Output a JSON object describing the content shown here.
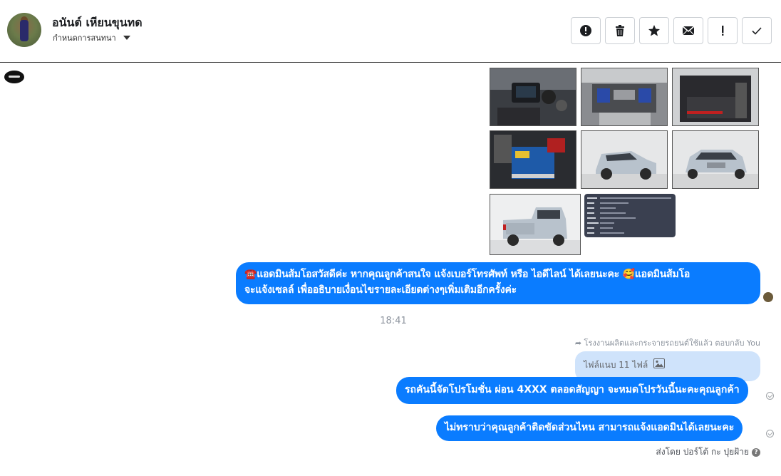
{
  "header": {
    "contact_name": "อนันต์ เหียนขุนทด",
    "assign_label": "กำหนดการสนทนา",
    "actions": [
      {
        "icon": "exclamation-circle-icon"
      },
      {
        "icon": "trash-icon"
      },
      {
        "icon": "star-icon"
      },
      {
        "icon": "envelope-icon"
      },
      {
        "icon": "exclamation-icon"
      },
      {
        "icon": "checkmark-icon"
      }
    ]
  },
  "gallery": {
    "images": [
      {
        "subject": "car interior dashboard"
      },
      {
        "subject": "engine bay"
      },
      {
        "subject": "truck bed red"
      },
      {
        "subject": "engine battery blue"
      },
      {
        "subject": "silver pickup front-left"
      },
      {
        "subject": "silver pickup front"
      },
      {
        "subject": "silver pickup rear"
      },
      {
        "subject": "vehicle info card dark"
      }
    ]
  },
  "messages": {
    "admin_message": "☎️ แอดมินส้มโอสวัสดีค่ะ หากคุณลูกค้าสนใจ แจ้งเบอร์โทรศัพท์ หรือ ไอดีไลน์  ได้เลยนะคะ 🥰 แอดมินส้มโอจะแจ้งเซลล์   เพื่ออธิบายเงื่อนไขรายละเอียดต่างๆเพิ่มเติมอีกครั้งค่ะ",
    "admin_message_line1": "☎️แอดมินส้มโอสวัสดีค่ะ หากคุณลูกค้าสนใจ แจ้งเบอร์โทรศัพท์ หรือ ไอดีไลน์  ได้เลยนะคะ 🥰แอดมินส้มโอ",
    "admin_message_line2": "จะแจ้งเซลล์   เพื่ออธิบายเงื่อนไขรายละเอียดต่างๆเพิ่มเติมอีกครั้งค่ะ",
    "timestamp": "18:41",
    "replied_label": "โรงงานผลิตและกระจายรถยนต์ใช้แล้ว ตอบกลับ You",
    "attachment_label": "ไฟล์แนบ 11 ไฟล์",
    "promo_message": "รถคันนี้จัดโปรโมชั่น ผ่อน 4XXX ตลอดสัญญา จะหมดโปรวันนี้นะคะคุณลูกค้า",
    "ask_message": "ไม่ทราบว่าคุณลูกค้าติดขัดส่วนไหน สามารถแจ้งแอดมินได้เลยนะคะ",
    "sent_by": "ส่งโดย ปอร์โต้ กะ ปุยฝ้าย",
    "help_glyph": "?"
  },
  "colors": {
    "bubble_blue": "#0a7cff",
    "attachment_bg": "#cfe3fb",
    "muted": "#8d949e"
  }
}
